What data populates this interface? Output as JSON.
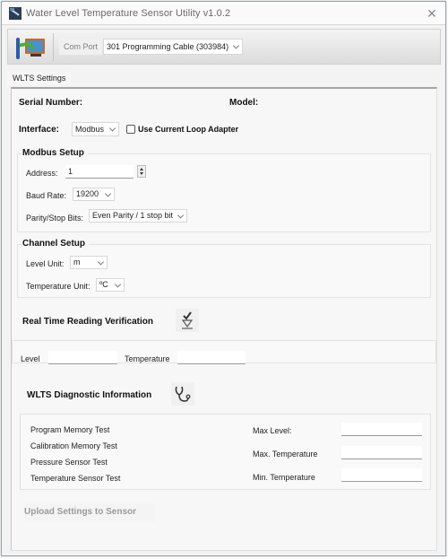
{
  "window": {
    "title": "Water Level Temperature Sensor Utility v1.0.2",
    "close_icon": "close-icon"
  },
  "toolbar": {
    "connect_icon": "connect-monitor-icon",
    "comport_label": "Com Port",
    "comport_value": "301 Programming Cable (303984)"
  },
  "tabs": [
    {
      "label": "WLTS Settings",
      "active": true
    }
  ],
  "settings": {
    "serial_number_label": "Serial Number:",
    "serial_number_value": "",
    "model_label": "Model:",
    "model_value": "",
    "interface_label": "Interface:",
    "interface_value": "Modbus",
    "current_loop_label": "Use Current Loop Adapter",
    "current_loop_checked": false
  },
  "modbus_setup": {
    "title": "Modbus Setup",
    "address_label": "Address:",
    "address_value": "1",
    "baud_label": "Baud Rate:",
    "baud_value": "19200",
    "parity_label": "Parity/Stop Bits:",
    "parity_value": "Even Parity / 1 stop bit"
  },
  "channel_setup": {
    "title": "Channel Setup",
    "level_unit_label": "Level Unit:",
    "level_unit_value": "m",
    "temp_unit_label": "Temperature Unit:",
    "temp_unit_value": "ºC"
  },
  "realtime": {
    "title": "Real Time Reading Verification",
    "icon": "verify-check-icon",
    "level_label": "Level",
    "level_value": "",
    "temperature_label": "Temperature",
    "temperature_value": ""
  },
  "diagnostic": {
    "title": "WLTS Diagnostic Information",
    "icon": "stethoscope-icon",
    "tests": [
      "Program Memory Test",
      "Calibration Memory Test",
      "Pressure Sensor Test",
      "Temperature Sensor Test"
    ],
    "max_level_label": "Max Level:",
    "max_level_value": "",
    "max_temp_label": "Max. Temperature",
    "max_temp_value": "",
    "min_temp_label": "Min. Temperature",
    "min_temp_value": ""
  },
  "upload_label": "Upload Settings to Sensor"
}
